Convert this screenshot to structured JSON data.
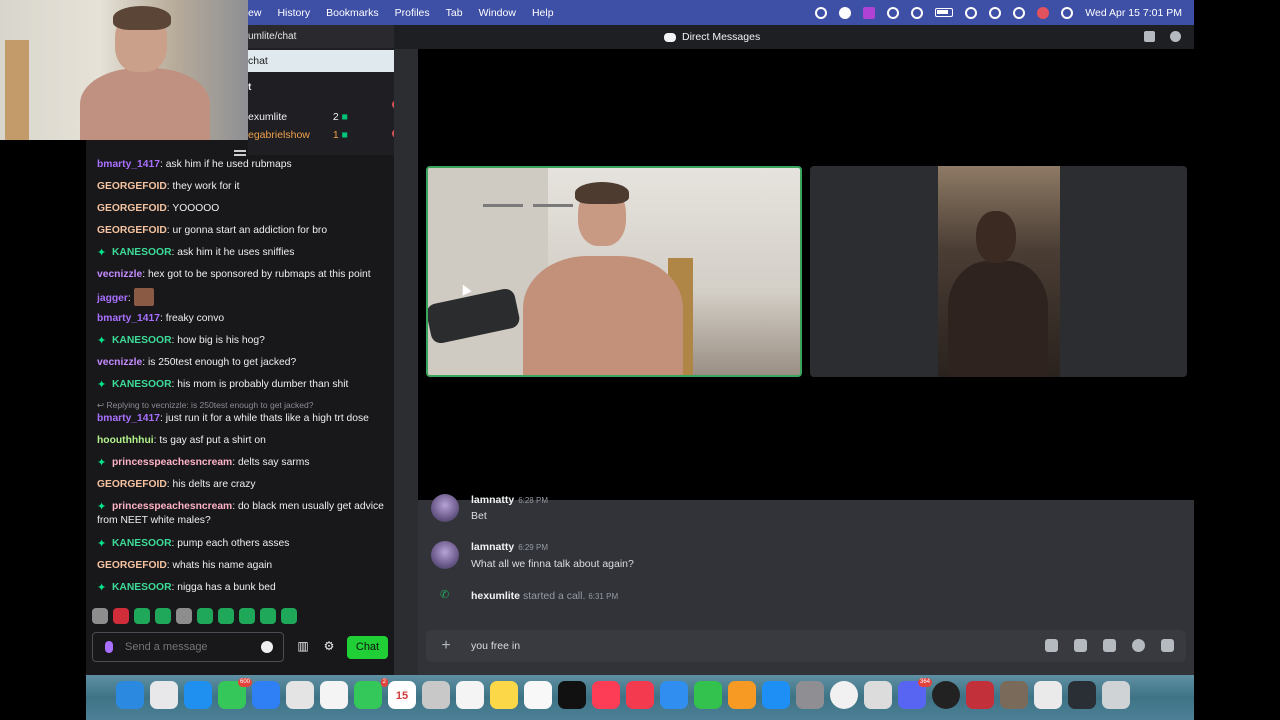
{
  "menubar": {
    "items": [
      "ew",
      "History",
      "Bookmarks",
      "Profiles",
      "Tab",
      "Window",
      "Help"
    ],
    "clock": "Wed Apr 15  7:01 PM"
  },
  "browser": {
    "url": "umlite/chat",
    "suggestion": "chat",
    "channel_header": "t",
    "viewers": [
      {
        "name": "exumlite",
        "count": "2"
      },
      {
        "name": "egabrielshow",
        "count": "1"
      }
    ],
    "notif_badge": "4"
  },
  "chat": {
    "messages": [
      {
        "user": "bmarty_1417",
        "text": "ask him if he used rubmaps",
        "color": "purple"
      },
      {
        "user": "GEORGEFOID",
        "text": "they work for it",
        "color": "peach"
      },
      {
        "user": "GEORGEFOID",
        "text": "YOOOOO",
        "color": "peach"
      },
      {
        "user": "GEORGEFOID",
        "text": "ur gonna start an addiction for bro",
        "color": "peach"
      },
      {
        "user": "KANESOOR",
        "text": "ask him it he uses sniffies",
        "color": "green",
        "badge": true
      },
      {
        "user": "vecnizzle",
        "text": "hex got to be sponsored by rubmaps at this point",
        "color": "violet"
      },
      {
        "user": "jagger",
        "text": "",
        "color": "purple",
        "emote": true
      },
      {
        "user": "bmarty_1417",
        "text": "freaky convo",
        "color": "purple"
      },
      {
        "user": "KANESOOR",
        "text": "how big is his hog?",
        "color": "green",
        "badge": true
      },
      {
        "user": "vecnizzle",
        "text": "is 250test enough to get jacked?",
        "color": "violet"
      },
      {
        "user": "KANESOOR",
        "text": "his mom is probably dumber than shit",
        "color": "green",
        "badge": true
      },
      {
        "user": "bmarty_1417",
        "text": "just run it for a while thats like a high trt dose",
        "color": "purple"
      },
      {
        "user": "hoouthhhui",
        "text": "ts gay asf put a shirt on",
        "color": "lime"
      },
      {
        "user": "princesspeachesncream",
        "text": "delts say sarms",
        "color": "pink",
        "badge": true
      },
      {
        "user": "GEORGEFOID",
        "text": "his delts are crazy",
        "color": "peach"
      },
      {
        "user": "princesspeachesncream",
        "text": "do black men usually get advice",
        "text2": "from NEET white males?",
        "color": "pink",
        "badge": true
      },
      {
        "user": "KANESOOR",
        "text": "pump each others asses",
        "color": "green",
        "badge": true
      },
      {
        "user": "GEORGEFOID",
        "text": "whats his name again",
        "color": "peach"
      },
      {
        "user": "KANESOOR",
        "text": "nigga has a bunk bed",
        "color": "green",
        "badge": true
      }
    ],
    "reply_hint": "Replying to vecnizzle: is 250test enough to get jacked?",
    "input_placeholder": "Send a message",
    "chat_button": "Chat"
  },
  "discord": {
    "title": "Direct Messages",
    "messages": [
      {
        "author": "lamnatty",
        "time": "6:28 PM",
        "text": "Bet"
      },
      {
        "author": "lamnatty",
        "time": "6:29 PM",
        "text": "What all we finna talk about again?"
      }
    ],
    "call": {
      "user": "hexumlite",
      "text": "started a call.",
      "time": "6:31 PM"
    },
    "composer_text": "you free in"
  },
  "dock": {
    "badges": {
      "messages": "600",
      "facetime": "2",
      "discord": "364"
    },
    "calendar_day": "15"
  },
  "colors": {
    "twitch_bg": "#18181b",
    "discord_bg": "#313338",
    "speaking_green": "#3ba55d",
    "chat_button": "#1fcf35"
  }
}
